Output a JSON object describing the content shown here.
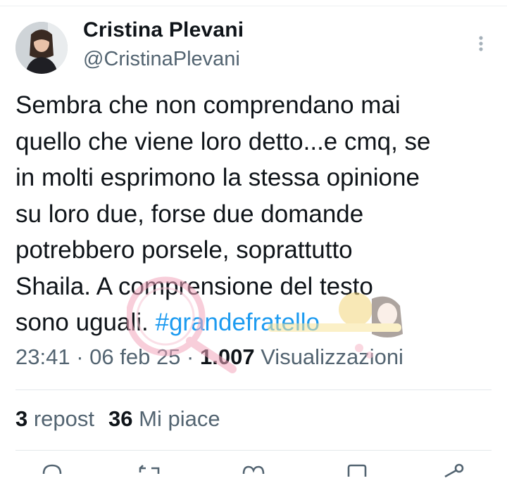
{
  "author": {
    "name": "Cristina Plevani",
    "handle": "@CristinaPlevani"
  },
  "tweet": {
    "text": "Sembra che non comprendano mai\nquello che viene loro detto...e cmq, se\nin molti esprimono la stessa opinione\nsu loro due, forse due domande\npotrebbero porsele, soprattutto\nShaila. A comprensione del testo\nsono uguali. ",
    "hashtag": "#grandefratello"
  },
  "meta": {
    "time": "23:41",
    "separator": " · ",
    "date": "06 feb 25",
    "views_count": "1.007",
    "views_label": " Visualizzazioni"
  },
  "stats": {
    "reposts_count": "3",
    "reposts_label": " repost",
    "likes_count": "36",
    "likes_label": " Mi piace"
  },
  "icons": {
    "more": "more-vertical-icon",
    "reply": "reply-icon",
    "repost": "repost-icon",
    "like": "like-icon",
    "bookmark": "bookmark-icon",
    "share": "share-icon"
  },
  "colors": {
    "text": "#0f1419",
    "secondary": "#536471",
    "link": "#1d9bf0",
    "divider": "#e4e8eb"
  }
}
